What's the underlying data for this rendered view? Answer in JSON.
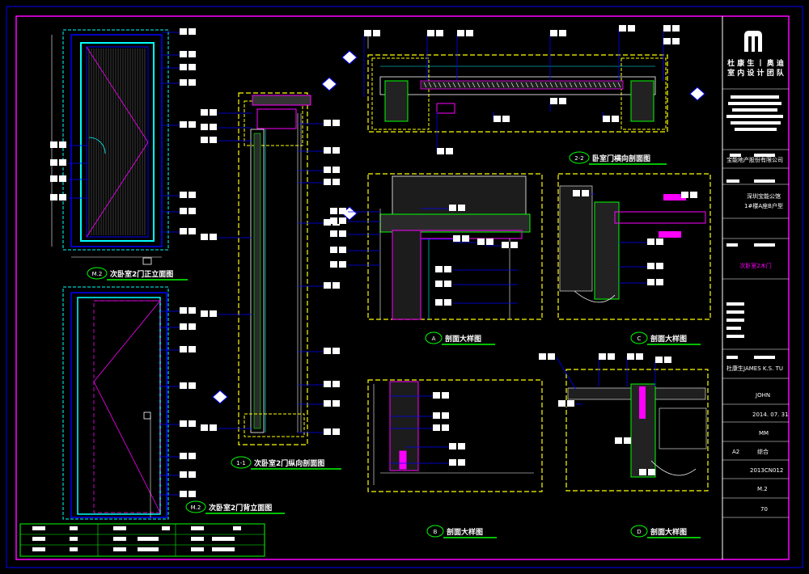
{
  "colors": {
    "background": "#000000",
    "frame": "#ff00ff",
    "outline": "#0000ff",
    "dim": "#00ffff",
    "section": "#ffff00",
    "leader": "#0000ff",
    "text": "#ffffff",
    "caption": "#00ff00",
    "accent": "#ff00ff"
  },
  "logo": {
    "icon": "studio-monogram-icon",
    "line1": "杜 康 生 丨 奥 迪",
    "line2": "室 内 设 计 团 队"
  },
  "title_block": {
    "client": "宝能地产股份有限公司",
    "project_name": "深圳宝能公馆",
    "project_sub": "1#楼A座B户型",
    "drawing_title": "次卧室2木门",
    "designer": "杜康生JAMES K.S. TU",
    "drawn_by": "JOHN",
    "date": "2014. 07. 31",
    "unit": "MM",
    "size": "A2",
    "category": "综合",
    "project_no": "2013CN012",
    "sheet_no": "M.2",
    "page_no": "70"
  },
  "captions": {
    "front_elevation_tag": "M.2",
    "front_elevation": "次卧室2门正立面图",
    "back_elevation_tag": "M.2",
    "back_elevation": "次卧室2门背立面图",
    "vertical_section_tag": "1-1",
    "vertical_section": "次卧室2门纵向剖面图",
    "horizontal_section_tag": "2-2",
    "horizontal_section": "卧室门横向剖面图",
    "detail_a_tag": "A",
    "detail_a": "剖面大样图",
    "detail_b_tag": "B",
    "detail_b": "剖面大样图",
    "detail_c_tag": "C",
    "detail_c": "剖面大样图",
    "detail_d_tag": "D",
    "detail_d": "剖面大样图"
  }
}
